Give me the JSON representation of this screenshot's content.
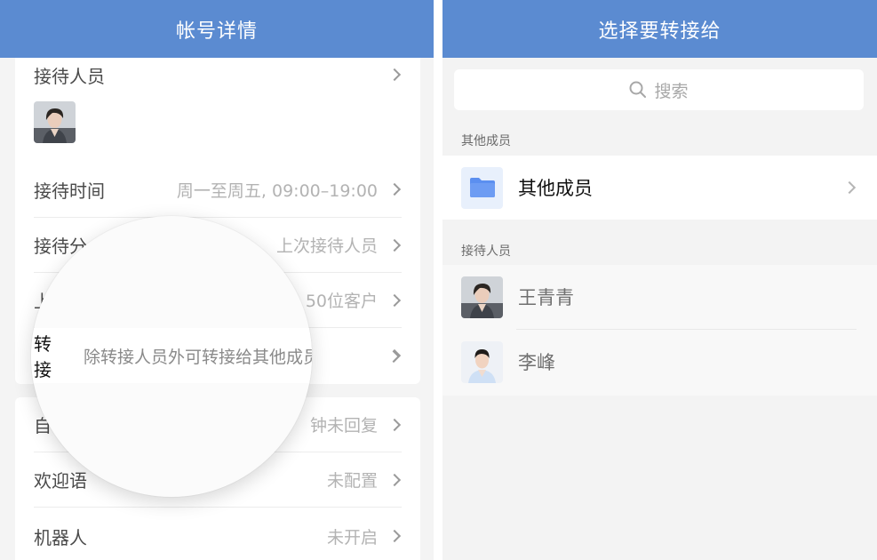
{
  "left": {
    "title": "帐号详情",
    "reception_staff_label": "接待人员",
    "reception_time": {
      "label": "接待时间",
      "value": "周一至周五, 09:00–19:00"
    },
    "reception_dist": {
      "label": "接待分",
      "value": "上次接待人员"
    },
    "row4": {
      "label": "上",
      "value": "50位客户"
    },
    "transfer": {
      "label": "转接",
      "value": "除转接人员外可转接给其他成员"
    },
    "auto_reply": {
      "label": "自",
      "value": "钟未回复"
    },
    "welcome": {
      "label": "欢迎语",
      "value": "未配置"
    },
    "robot": {
      "label": "机器人",
      "value": "未开启"
    }
  },
  "right": {
    "title": "选择要转接给",
    "search_placeholder": "搜索",
    "other_members_section": "其他成员",
    "other_members_item": "其他成员",
    "reception_section": "接待人员",
    "members": [
      {
        "name": "王青青"
      },
      {
        "name": "李峰"
      }
    ]
  },
  "colors": {
    "header": "#5b8bd1",
    "folder": "#5b8ff0"
  },
  "icons": [
    "chevron-right-icon",
    "search-icon",
    "folder-icon",
    "avatar-female",
    "avatar-male"
  ]
}
